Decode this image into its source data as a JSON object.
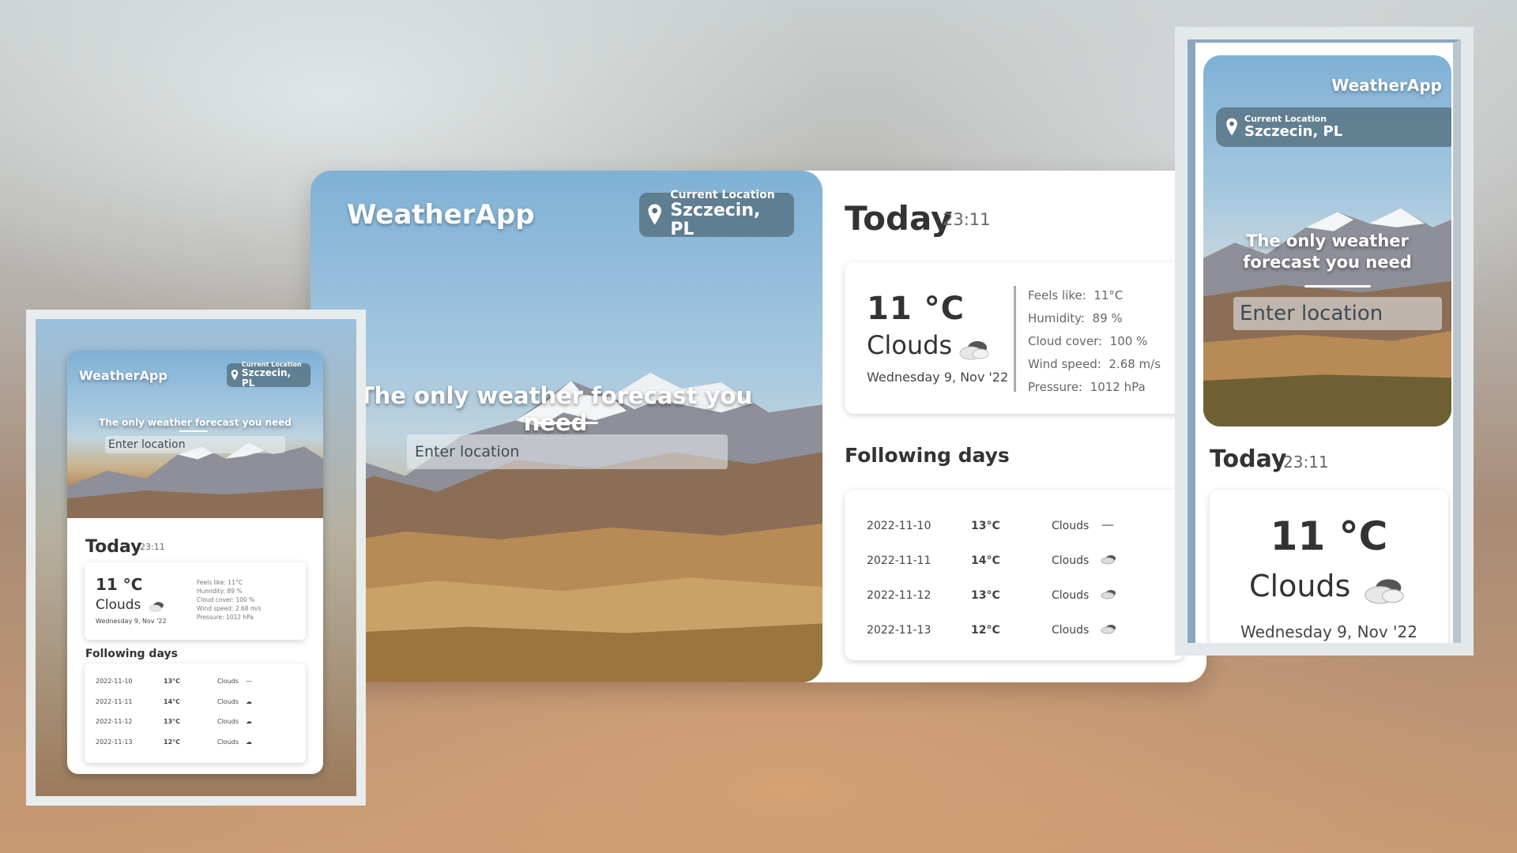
{
  "app": {
    "name": "WeatherApp",
    "location_label": "Current Location",
    "location": "Szczecin, PL",
    "tagline": "The only weather forecast you need",
    "tagline_line1": "The only weather",
    "tagline_line2": "forecast you need",
    "search_placeholder": "Enter location"
  },
  "today": {
    "title": "Today",
    "time": "23:11",
    "temperature": "11°C",
    "temperature_spaced": "11 °C",
    "condition": "Clouds",
    "condition_icon": "cloud-night-icon",
    "date": "Wednesday 9, Nov '22",
    "details": [
      {
        "label": "Feels like:",
        "value": "11°C"
      },
      {
        "label": "Humidity:",
        "value": "89 %"
      },
      {
        "label": "Cloud cover:",
        "value": "100 %"
      },
      {
        "label": "Wind speed:",
        "value": "2.68 m/s"
      },
      {
        "label": "Pressure:",
        "value": "1012 hPa"
      }
    ]
  },
  "following": {
    "title": "Following days",
    "days": [
      {
        "date": "2022-11-10",
        "temp": "13°C",
        "condition": "Clouds",
        "icon": "fog-icon"
      },
      {
        "date": "2022-11-11",
        "temp": "14°C",
        "condition": "Clouds",
        "icon": "cloud-icon"
      },
      {
        "date": "2022-11-12",
        "temp": "13°C",
        "condition": "Clouds",
        "icon": "cloud-icon"
      },
      {
        "date": "2022-11-13",
        "temp": "12°C",
        "condition": "Clouds",
        "icon": "cloud-icon"
      }
    ]
  },
  "colors": {
    "location_pill": "#546e7d",
    "sky_top": "#7fb1d6",
    "text_dark": "#333333"
  }
}
